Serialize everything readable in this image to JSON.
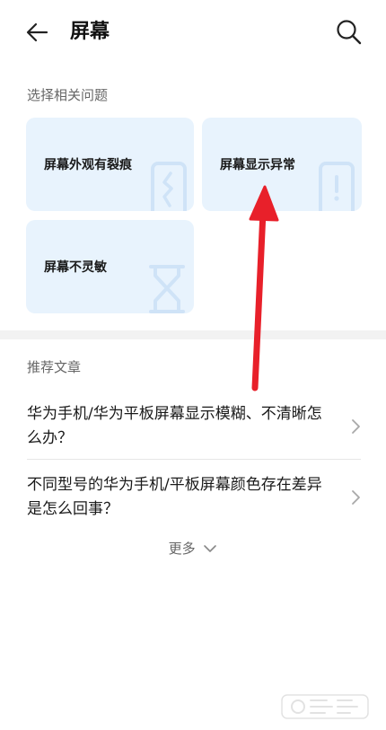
{
  "header": {
    "title": "屏幕",
    "back_icon": "arrow-left-icon",
    "search_icon": "search-icon"
  },
  "related_questions": {
    "label": "选择相关问题",
    "items": [
      {
        "label": "屏幕外观有裂痕",
        "icon": "cracked-phone-icon"
      },
      {
        "label": "屏幕显示异常",
        "icon": "phone-alert-icon"
      },
      {
        "label": "屏幕不灵敏",
        "icon": "hourglass-icon"
      }
    ]
  },
  "recommended": {
    "label": "推荐文章",
    "articles": [
      {
        "title": "华为手机/华为平板屏幕显示模糊、不清晰怎么办？"
      },
      {
        "title": "不同型号的华为手机/平板屏幕颜色存在差异是怎么回事？"
      }
    ],
    "more_label": "更多"
  },
  "colors": {
    "card_bg": "#e8f3fd",
    "card_icon": "#cfe3f7",
    "annotation_arrow": "#e8202a"
  }
}
